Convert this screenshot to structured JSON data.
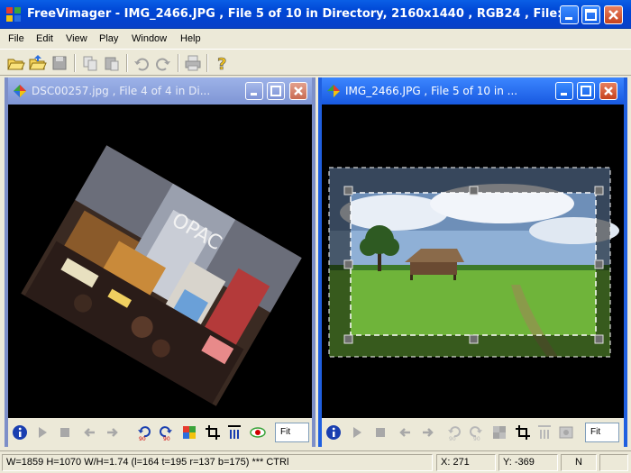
{
  "app": {
    "title": "FreeVimager - IMG_2466.JPG , File 5 of 10 in Directory, 2160x1440 , RGB24 , File: ..."
  },
  "menu": [
    "File",
    "Edit",
    "View",
    "Play",
    "Window",
    "Help"
  ],
  "toolbar_icons": [
    "open-icon",
    "open-folder-icon",
    "save-icon",
    "copy-icon",
    "paste-icon",
    "undo-icon",
    "redo-icon",
    "print-icon",
    "help-icon"
  ],
  "left_window": {
    "title": "DSC00257.jpg , File 4 of 4 in Di...",
    "zoom": "Fit",
    "sign_text": "OPAC"
  },
  "right_window": {
    "title": "IMG_2466.JPG , File 5 of 10 in ...",
    "zoom": "Fit"
  },
  "status": {
    "info": "W=1859 H=1070 W/H=1.74 (l=164 t=195 r=137 b=175) *** CTRl",
    "x": "X: 271",
    "y": "Y: -369",
    "mode": "N"
  },
  "colors": {
    "titlebar": "#0046d5",
    "inactive_child": "#7d8fc8",
    "active_child": "#1f5fe0",
    "chrome": "#ece9d8"
  }
}
